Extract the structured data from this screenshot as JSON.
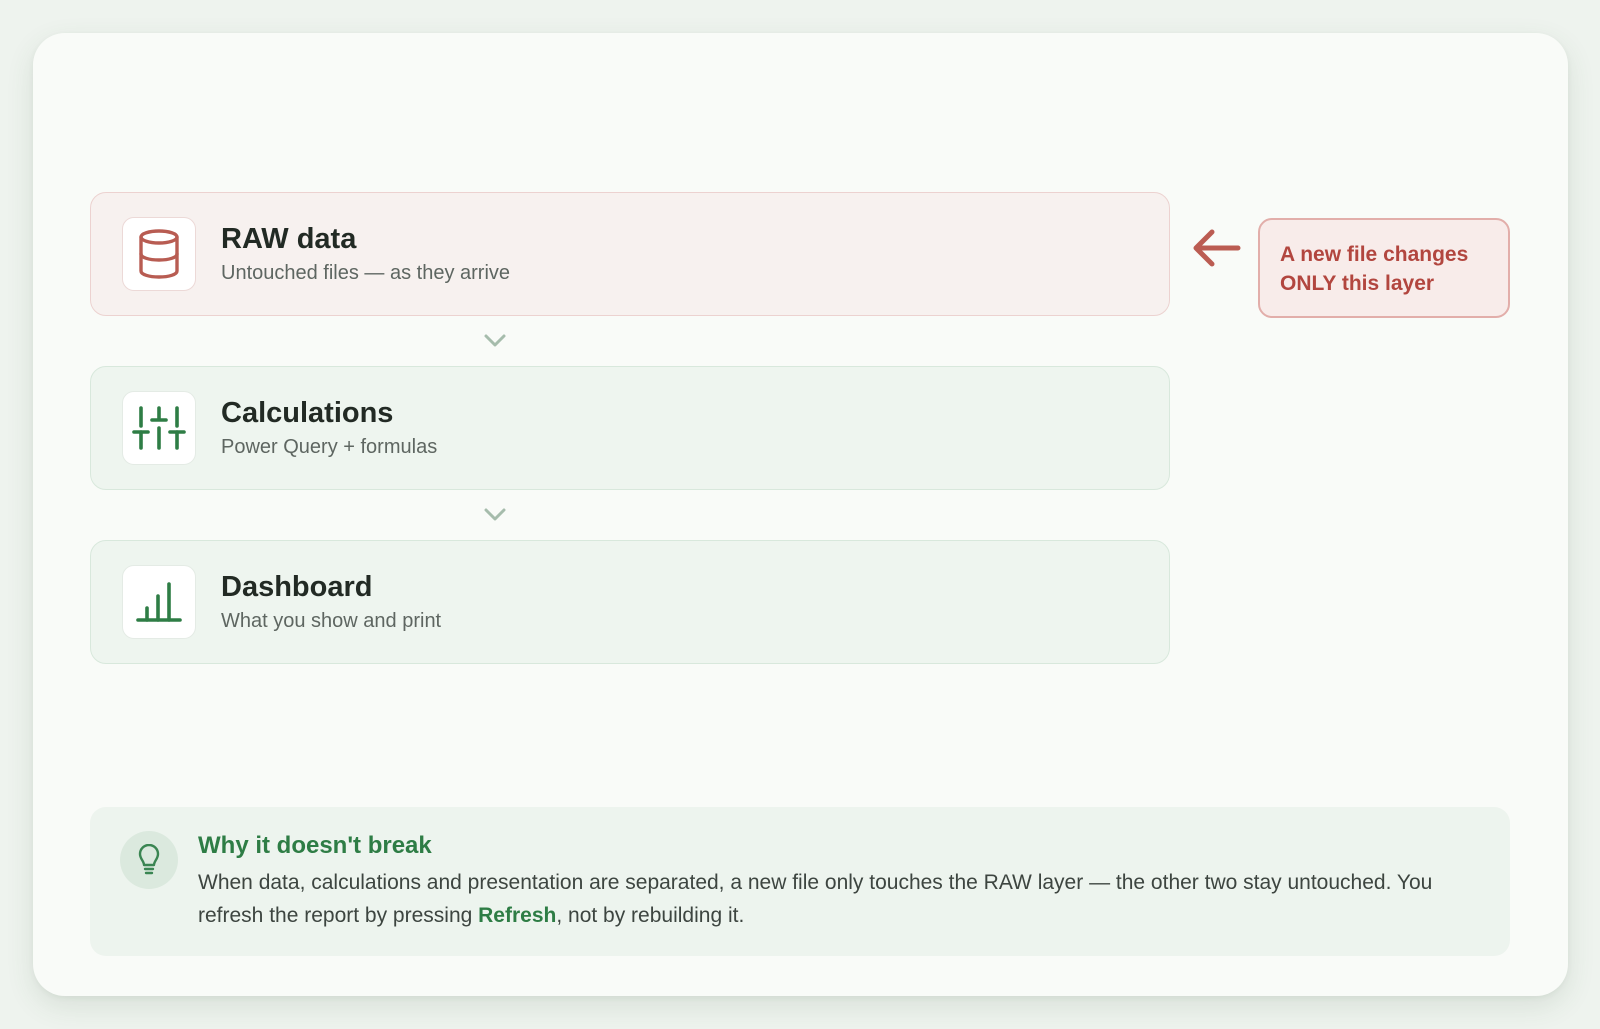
{
  "layers": [
    {
      "title": "RAW data",
      "subtitle": "Untouched files — as they arrive",
      "icon": "database-icon",
      "accent": "#b85c52"
    },
    {
      "title": "Calculations",
      "subtitle": "Power Query + formulas",
      "icon": "sliders-icon",
      "accent": "#2e7d45"
    },
    {
      "title": "Dashboard",
      "subtitle": "What you show and print",
      "icon": "bar-chart-icon",
      "accent": "#2e7d45"
    }
  ],
  "callout": {
    "line1": "A new file changes",
    "line2": "ONLY this layer",
    "color": "#b2463f"
  },
  "why": {
    "title": "Why it doesn't break",
    "text_before": "When data, calculations and presentation are separated, a new file only touches the RAW layer — the other two stay untouched. You refresh the report by pressing ",
    "highlight": "Refresh",
    "text_after": ", not by rebuilding it.",
    "icon": "lightbulb-icon"
  }
}
